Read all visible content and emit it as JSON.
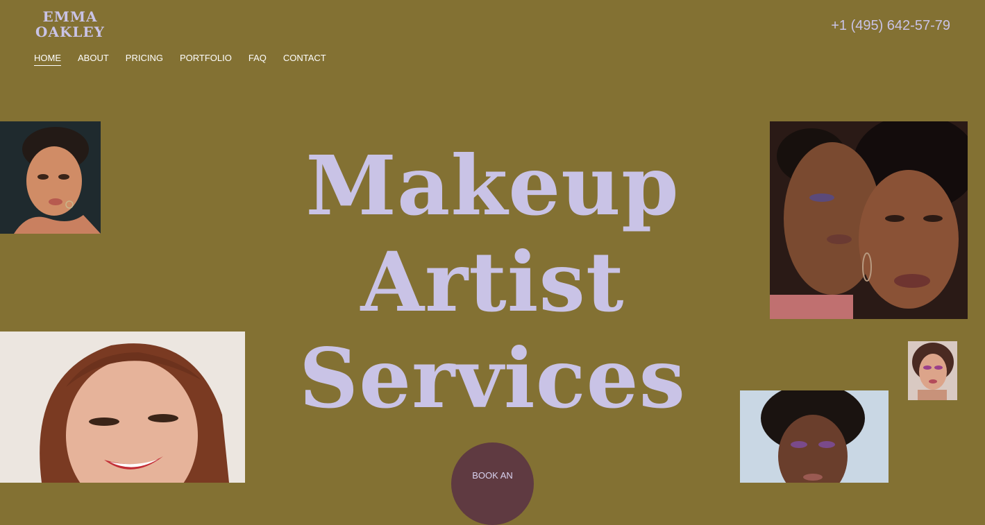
{
  "brand": {
    "line1": "EMMA",
    "line2": "OAKLEY"
  },
  "contact": {
    "phone": "+1 (495) 642-57-79"
  },
  "nav": {
    "items": [
      {
        "label": "HOME",
        "active": true
      },
      {
        "label": "ABOUT",
        "active": false
      },
      {
        "label": "PRICING",
        "active": false
      },
      {
        "label": "PORTFOLIO",
        "active": false
      },
      {
        "label": "FAQ",
        "active": false
      },
      {
        "label": "CONTACT",
        "active": false
      }
    ]
  },
  "hero": {
    "line1": "Makeup",
    "line2": "Artist",
    "line3": "Services",
    "cta_label": "BOOK AN"
  },
  "colors": {
    "background": "#837133",
    "accent": "#c9c3e6",
    "button": "#5f3a41"
  }
}
